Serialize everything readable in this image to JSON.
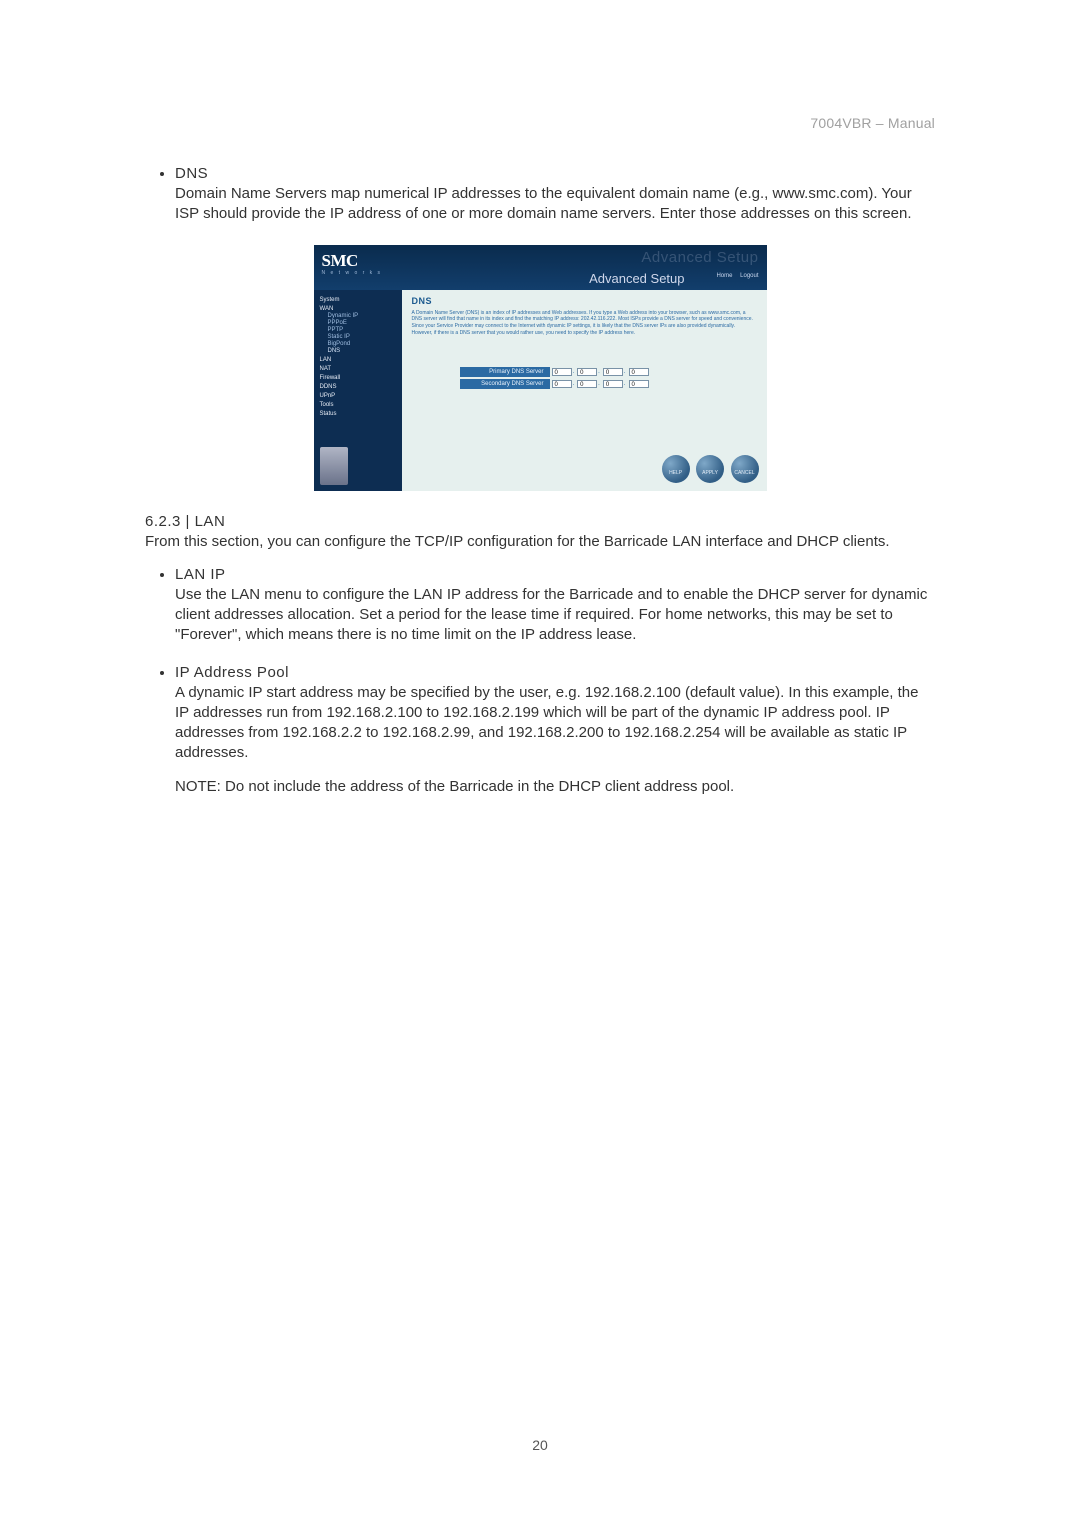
{
  "doc_header": "7004VBR – Manual",
  "page_number": "20",
  "dns_section": {
    "title": "DNS",
    "text": "Domain Name Servers map numerical IP addresses to the equivalent domain name (e.g., www.smc.com). Your ISP should provide the IP address of one or more domain name servers. Enter those addresses on this screen."
  },
  "lan_section": {
    "heading": "6.2.3 | LAN",
    "intro": "From this section, you can configure the TCP/IP configuration for the Barricade LAN interface and DHCP clients.",
    "lan_ip": {
      "title": "LAN IP",
      "text": "Use the LAN menu to configure the LAN IP address for the Barricade and to enable the DHCP server for dynamic client addresses allocation. Set a period for the lease time if required. For home networks, this may be set to \"Forever\", which means there is no time limit on the IP address lease."
    },
    "ip_pool": {
      "title": "IP Address Pool",
      "text": "A dynamic IP start address may be specified by the user, e.g. 192.168.2.100 (default value). In this example, the IP addresses run from 192.168.2.100 to 192.168.2.199 which will be part of the dynamic IP address pool. IP addresses from 192.168.2.2 to 192.168.2.99, and 192.168.2.200 to 192.168.2.254 will be available as static IP addresses.",
      "note": "NOTE: Do not include the address of the Barricade in the DHCP client address pool."
    }
  },
  "screenshot": {
    "logo": "SMC",
    "logo_sub": "N e t w o r k s",
    "ghost_heading": "Advanced Setup",
    "heading": "Advanced Setup",
    "toplink_home": "Home",
    "toplink_logout": "Logout",
    "sidebar": {
      "system": "System",
      "wan": "WAN",
      "dynamic_ip": "Dynamic IP",
      "pppoe": "PPPoE",
      "pptp": "PPTP",
      "static_ip": "Static IP",
      "bigpond": "BigPond",
      "dns": "DNS",
      "lan": "LAN",
      "nat": "NAT",
      "firewall": "Firewall",
      "ddns": "DDNS",
      "upnp": "UPnP",
      "tools": "Tools",
      "status": "Status"
    },
    "main": {
      "title": "DNS",
      "desc": "A Domain Name Server (DNS) is an index of IP addresses and Web addresses. If you type a Web address into your browser, such as www.smc.com, a DNS server will find that name in its index and find the matching IP address: 202.42.116.222. Most ISPs provide a DNS server for speed and convenience. Since your Service Provider may connect to the Internet with dynamic IP settings, it is likely that the DNS server IPs are also provided dynamically. However, if there is a DNS server that you would rather use, you need to specify the IP address here.",
      "primary_label": "Primary DNS Server",
      "secondary_label": "Secondary DNS Server",
      "oct1": "0",
      "oct2": "0",
      "oct3": "0",
      "oct4": "0"
    },
    "buttons": {
      "help": "HELP",
      "apply": "APPLY",
      "cancel": "CANCEL"
    }
  }
}
